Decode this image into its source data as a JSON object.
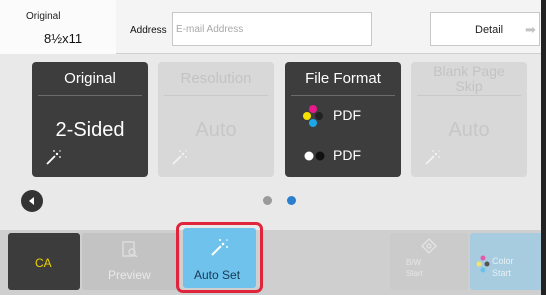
{
  "topbar": {
    "original_label": "Original",
    "original_size": "8½x11",
    "address_label": "Address",
    "address_placeholder": "E-mail Address",
    "detail_label": "Detail"
  },
  "tiles": [
    {
      "title": "Original",
      "value": "2-Sided",
      "state": "active"
    },
    {
      "title": "Resolution",
      "value": "Auto",
      "state": "disabled"
    },
    {
      "title": "File Format",
      "formats": [
        "PDF",
        "PDF"
      ],
      "state": "active"
    },
    {
      "title_line1": "Blank Page",
      "title_line2": "Skip",
      "value": "Auto",
      "state": "disabled"
    }
  ],
  "pager": {
    "current_page": 2,
    "total_pages": 2
  },
  "bottombar": {
    "ca_label": "CA",
    "preview_label": "Preview",
    "autoset_label": "Auto Set",
    "bw_line1": "B/W",
    "bw_line2": "Start",
    "color_line1": "Color",
    "color_line2": "Start"
  },
  "colors": {
    "accent_blue": "#6ec2ec",
    "highlight_red": "#e0243b",
    "tile_dark": "#3d3d3d",
    "ca_yellow": "#f0d000",
    "page_dot_active": "#2a7fcf"
  }
}
